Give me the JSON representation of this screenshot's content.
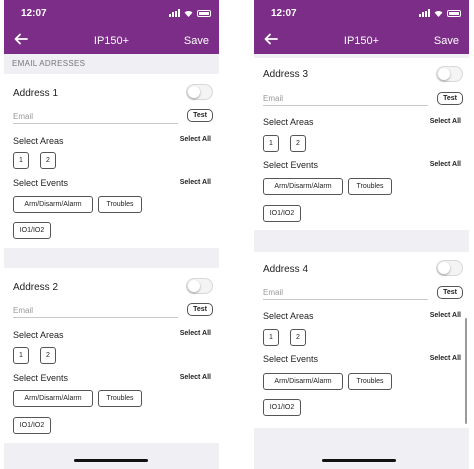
{
  "status": {
    "time": "12:07"
  },
  "nav": {
    "title": "IP150+",
    "save": "Save"
  },
  "section": {
    "email_header": "EMAIL ADRESSES"
  },
  "common": {
    "email_placeholder": "Email",
    "test_label": "Test",
    "select_areas": "Select Areas",
    "select_events": "Select Events",
    "select_all": "Select All",
    "areas": [
      "1",
      "2"
    ],
    "events": [
      "Arm/Disarm/Alarm",
      "Troubles",
      "IO1/IO2"
    ]
  },
  "addresses": [
    {
      "title": "Address 1"
    },
    {
      "title": "Address 2"
    },
    {
      "title": "Address 3"
    },
    {
      "title": "Address 4"
    }
  ],
  "colors": {
    "brand_purple": "#7b2d87",
    "background": "#efeff4"
  }
}
